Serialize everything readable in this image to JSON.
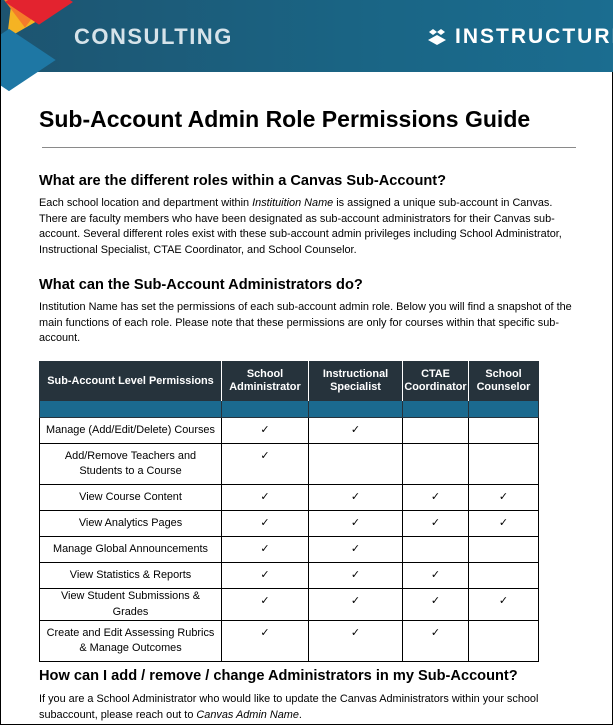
{
  "banner": {
    "left_label": "CONSULTING",
    "brand_name": "INSTRUCTURE",
    "colors": {
      "background": "#1a6585",
      "accent_red": "#e3232f",
      "accent_orange": "#f47b2a",
      "accent_yellow": "#f5b323",
      "accent_blue": "#1e77a4"
    }
  },
  "document": {
    "title": "Sub-Account Admin Role Permissions Guide",
    "section1": {
      "heading": "What are the different roles within a Canvas Sub-Account?",
      "text_before": "Each school location and department within ",
      "text_italic": "Instituition Name",
      "text_after": " is assigned a unique sub-account in Canvas. There are faculty members who have been designated as sub-account administrators for their Canvas sub-account.  Several different roles exist with these sub-account admin privileges including School Administrator, Instructional Specialist, CTAE Coordinator, and School Counselor."
    },
    "section2": {
      "heading": "What can the Sub-Account Administrators do?",
      "text": "Institution Name has set the permissions of each sub-account admin role.  Below you will find a snapshot of the main functions of each role. Please note that these permissions are only for courses within that specific sub-account."
    },
    "section3": {
      "heading": "How can I add / remove / change Administrators in my Sub-Account?",
      "text_before": "If you are a School Administrator who would like to update the Canvas Administrators within your school subaccount, please reach out to ",
      "text_italic": "Canvas Admin Name",
      "text_after": "."
    }
  },
  "table": {
    "check_glyph": "✓",
    "headers": [
      "Sub-Account Level Permissions",
      "School Administrator",
      "Instructional Specialist",
      "CTAE Coordinator",
      "School Counselor"
    ],
    "colors": {
      "header_bg": "#26333c",
      "band_bg": "#1b6a8f"
    },
    "rows": [
      {
        "permission": "Manage (Add/Edit/Delete) Courses",
        "checks": [
          true,
          true,
          false,
          false
        ]
      },
      {
        "permission": "Add/Remove Teachers and Students to a Course",
        "checks": [
          true,
          false,
          false,
          false
        ]
      },
      {
        "permission": "View Course Content",
        "checks": [
          true,
          true,
          true,
          true
        ]
      },
      {
        "permission": "View Analytics Pages",
        "checks": [
          true,
          true,
          true,
          true
        ]
      },
      {
        "permission": "Manage Global Announcements",
        "checks": [
          true,
          true,
          false,
          false
        ]
      },
      {
        "permission": "View Statistics & Reports",
        "checks": [
          true,
          true,
          true,
          false
        ]
      },
      {
        "permission": "View Student Submissions & Grades",
        "checks": [
          true,
          true,
          true,
          true
        ]
      },
      {
        "permission": "Create and Edit Assessing Rubrics & Manage Outcomes",
        "checks": [
          true,
          true,
          true,
          false
        ]
      }
    ]
  }
}
